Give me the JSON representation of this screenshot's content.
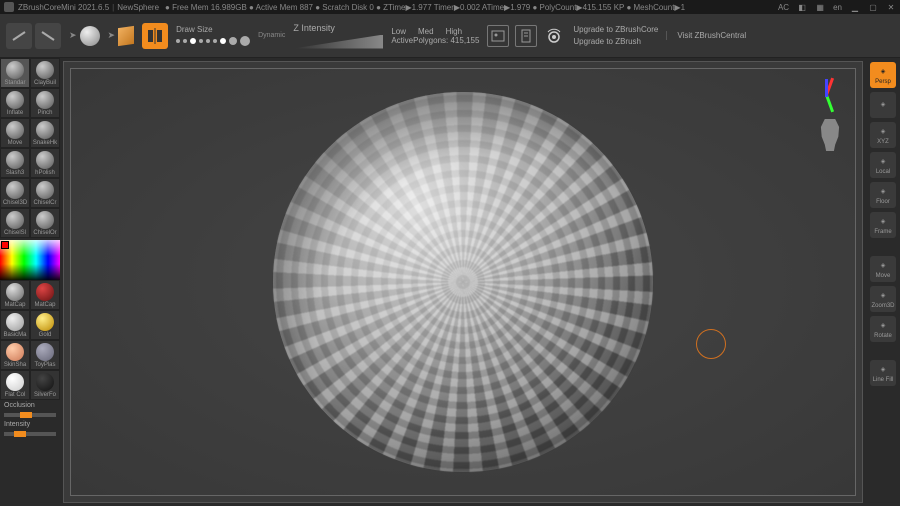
{
  "titlebar": {
    "app": "ZBrushCoreMini 2021.6.5",
    "doc": "NewSphere",
    "stats": "● Free Mem 16.989GB ● Active Mem 887 ● Scratch Disk 0 ● ZTime▶1.977 Timer▶0.002 ATime▶1.979 ● PolyCount▶415.155 KP ● MeshCount▶1",
    "ac": "AC",
    "lang": "en"
  },
  "toolbar": {
    "draw_size": "Draw Size",
    "dynamic": "Dynamic",
    "z_intensity": "Z Intensity",
    "low": "Low",
    "med": "Med",
    "high": "High",
    "active_polygons_label": "ActivePolygons:",
    "active_polygons": "415,155",
    "upgrade1": "Upgrade to ZBrushCore",
    "upgrade2": "Upgrade to ZBrush",
    "visit": "Visit ZBrushCentral"
  },
  "brushes": [
    {
      "label": "Standar",
      "sel": true
    },
    {
      "label": "ClayBuil"
    },
    {
      "label": "Inflate"
    },
    {
      "label": "Pinch"
    },
    {
      "label": "Move"
    },
    {
      "label": "SnakeHk"
    },
    {
      "label": "Slash3"
    },
    {
      "label": "hPolish"
    },
    {
      "label": "Chisel3D"
    },
    {
      "label": "ChiselCr"
    },
    {
      "label": "ChiselSl"
    },
    {
      "label": "ChiselOr"
    }
  ],
  "materials": [
    {
      "label": "MatCap",
      "cls": "m1"
    },
    {
      "label": "MatCap",
      "cls": "m2"
    },
    {
      "label": "BasicMa",
      "cls": "m3"
    },
    {
      "label": "Gold",
      "cls": "m4"
    },
    {
      "label": "SkinSha",
      "cls": "m5"
    },
    {
      "label": "ToyPlas",
      "cls": "m6"
    },
    {
      "label": "Flat Col",
      "cls": "m7"
    },
    {
      "label": "SilverFo",
      "cls": "m8"
    }
  ],
  "left_misc": {
    "occlusion": "Occlusion",
    "intensity": "Intensity"
  },
  "right_panel": [
    {
      "name": "persp",
      "label": "Persp",
      "active": true
    },
    {
      "name": "frame",
      "label": ""
    },
    {
      "name": "xyz",
      "label": "XYZ"
    },
    {
      "name": "local",
      "label": "Local"
    },
    {
      "name": "floor",
      "label": "Floor"
    },
    {
      "name": "frame2",
      "label": "Frame"
    },
    {
      "name": "sep"
    },
    {
      "name": "move",
      "label": "Move"
    },
    {
      "name": "zoom",
      "label": "Zoom3D"
    },
    {
      "name": "rotate",
      "label": "Rotate"
    },
    {
      "name": "sep"
    },
    {
      "name": "linefill",
      "label": "Line Fill"
    }
  ]
}
